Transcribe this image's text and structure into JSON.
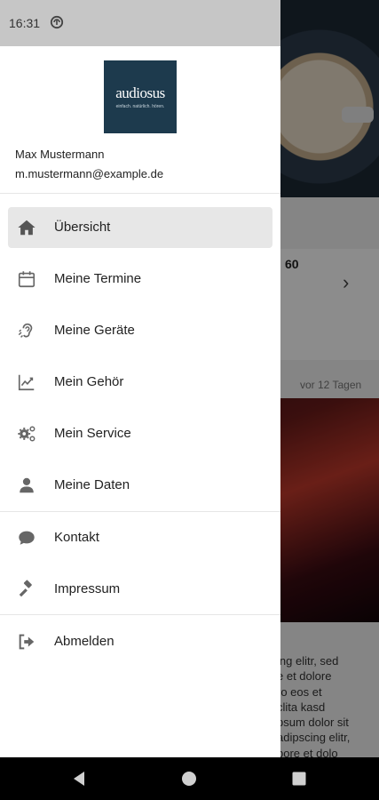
{
  "status_bar": {
    "time": "16:31"
  },
  "background": {
    "card_value": "60",
    "news_date": "vor 12 Tagen",
    "news_text": "ing elitr, sed\ne et dolore\nro eos et\nclita kasd\npsum dolor sit\nadipscing elitr,\nbore et dolo"
  },
  "drawer": {
    "logo": {
      "word": "audiosus",
      "tagline": "einfach. natürlich. hören."
    },
    "user": {
      "name": "Max Mustermann",
      "email": "m.mustermann@example.de"
    },
    "menu": [
      {
        "label": "Übersicht",
        "icon": "home-icon",
        "active": true
      },
      {
        "label": "Meine Termine",
        "icon": "calendar-icon"
      },
      {
        "label": "Meine Geräte",
        "icon": "hearing-icon"
      },
      {
        "label": "Mein Gehör",
        "icon": "chart-icon"
      },
      {
        "label": "Mein Service",
        "icon": "gears-icon"
      },
      {
        "label": "Meine Daten",
        "icon": "person-icon"
      },
      {
        "label": "Kontakt",
        "icon": "chat-bubble-icon"
      },
      {
        "label": "Impressum",
        "icon": "gavel-icon"
      },
      {
        "label": "Abmelden",
        "icon": "sign-out-icon"
      }
    ]
  },
  "colors": {
    "icon": "#666666",
    "active_bg": "#e7e7e7",
    "logo_bg": "#1d3a4d"
  }
}
